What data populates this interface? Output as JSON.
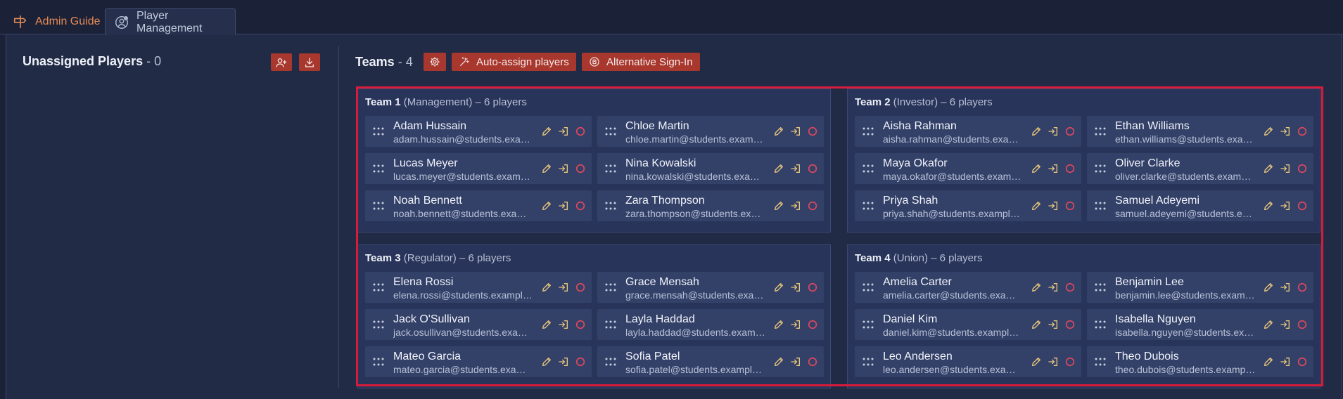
{
  "tabs": [
    {
      "label": "Admin Guide",
      "icon": "signpost-icon"
    },
    {
      "label": "Player Management",
      "icon": "user-circle-icon"
    }
  ],
  "unassigned": {
    "title": "Unassigned Players",
    "count": "- 0",
    "buttons": [
      {
        "icon": "add-user-icon"
      },
      {
        "icon": "download-icon"
      }
    ]
  },
  "teams_header": {
    "title": "Teams",
    "count": "- 4",
    "settings_icon": "gear-icon",
    "auto_assign_label": "Auto-assign players",
    "alt_signin_label": "Alternative Sign-In"
  },
  "colors": {
    "accent_red": "#a8372d",
    "highlight": "#d81b3a",
    "edit_icon": "#e9c77a",
    "remove_icon": "#e4475c"
  },
  "teams": [
    {
      "name": "Team 1",
      "role": "(Management)",
      "count_text": "– 6 players",
      "players": [
        {
          "name": "Adam Hussain",
          "email": "adam.hussain@students.example.com"
        },
        {
          "name": "Chloe Martin",
          "email": "chloe.martin@students.example.com"
        },
        {
          "name": "Lucas Meyer",
          "email": "lucas.meyer@students.example.com"
        },
        {
          "name": "Nina Kowalski",
          "email": "nina.kowalski@students.example.com"
        },
        {
          "name": "Noah Bennett",
          "email": "noah.bennett@students.example.com"
        },
        {
          "name": "Zara Thompson",
          "email": "zara.thompson@students.example.com"
        }
      ]
    },
    {
      "name": "Team 2",
      "role": "(Investor)",
      "count_text": "– 6 players",
      "players": [
        {
          "name": "Aisha Rahman",
          "email": "aisha.rahman@students.example.com"
        },
        {
          "name": "Ethan Williams",
          "email": "ethan.williams@students.example.com"
        },
        {
          "name": "Maya Okafor",
          "email": "maya.okafor@students.example.com"
        },
        {
          "name": "Oliver Clarke",
          "email": "oliver.clarke@students.example.com"
        },
        {
          "name": "Priya Shah",
          "email": "priya.shah@students.example.com"
        },
        {
          "name": "Samuel Adeyemi",
          "email": "samuel.adeyemi@students.example.com"
        }
      ]
    },
    {
      "name": "Team 3",
      "role": "(Regulator)",
      "count_text": "– 6 players",
      "players": [
        {
          "name": "Elena Rossi",
          "email": "elena.rossi@students.example.com"
        },
        {
          "name": "Grace Mensah",
          "email": "grace.mensah@students.example.com"
        },
        {
          "name": "Jack O'Sullivan",
          "email": "jack.osullivan@students.example.com"
        },
        {
          "name": "Layla Haddad",
          "email": "layla.haddad@students.example.com"
        },
        {
          "name": "Mateo Garcia",
          "email": "mateo.garcia@students.example.com"
        },
        {
          "name": "Sofia Patel",
          "email": "sofia.patel@students.example.com"
        }
      ]
    },
    {
      "name": "Team 4",
      "role": "(Union)",
      "count_text": "– 6 players",
      "players": [
        {
          "name": "Amelia Carter",
          "email": "amelia.carter@students.example.com"
        },
        {
          "name": "Benjamin Lee",
          "email": "benjamin.lee@students.example.com"
        },
        {
          "name": "Daniel Kim",
          "email": "daniel.kim@students.example.com"
        },
        {
          "name": "Isabella Nguyen",
          "email": "isabella.nguyen@students.example.com"
        },
        {
          "name": "Leo Andersen",
          "email": "leo.andersen@students.example.com"
        },
        {
          "name": "Theo Dubois",
          "email": "theo.dubois@students.example.com"
        }
      ]
    }
  ]
}
